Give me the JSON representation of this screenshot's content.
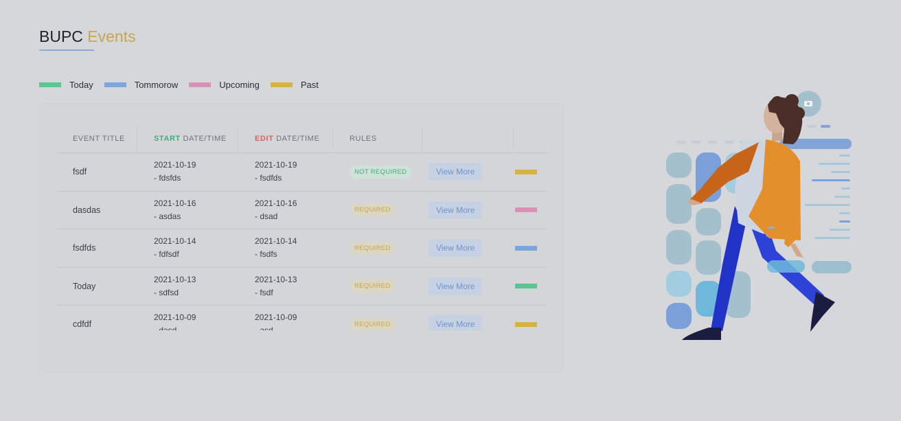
{
  "header": {
    "title_main": "BUPC",
    "title_accent": "Events"
  },
  "colors": {
    "today": "#5bc592",
    "tomorrow": "#7ca5de",
    "upcoming": "#d991b7",
    "past": "#d9b13d"
  },
  "legend": [
    {
      "label": "Today",
      "color": "#5bc592"
    },
    {
      "label": "Tommorow",
      "color": "#7ca5de"
    },
    {
      "label": "Upcoming",
      "color": "#d991b7"
    },
    {
      "label": "Past",
      "color": "#d9b13d"
    }
  ],
  "table": {
    "headers": {
      "event_title": "EVENT TITLE",
      "start_hl": "START",
      "start_rest": " DATE/TIME",
      "edit_hl": "EDIT",
      "edit_rest": " DATE/TIME",
      "rules": "RULES"
    },
    "view_more_label": "View More",
    "rows": [
      {
        "title": "fsdf",
        "start_date": "2021-10-19",
        "start_sub": "- fdsfds",
        "edit_date": "2021-10-19",
        "edit_sub": "- fsdfds",
        "rule": "NOT REQUIRED",
        "status": "upcoming-past",
        "bar_color": "#d9b13d"
      },
      {
        "title": "dasdas",
        "start_date": "2021-10-16",
        "start_sub": "- asdas",
        "edit_date": "2021-10-16",
        "edit_sub": "- dsad",
        "rule": "REQUIRED",
        "bar_color": "#d991b7"
      },
      {
        "title": "fsdfds",
        "start_date": "2021-10-14",
        "start_sub": "- fdfsdf",
        "edit_date": "2021-10-14",
        "edit_sub": "- fsdfs",
        "rule": "REQUIRED",
        "bar_color": "#7ca5de"
      },
      {
        "title": "Today",
        "start_date": "2021-10-13",
        "start_sub": "- sdfsd",
        "edit_date": "2021-10-13",
        "edit_sub": "- fsdf",
        "rule": "REQUIRED",
        "bar_color": "#5bc592"
      },
      {
        "title": "cdfdf",
        "start_date": "2021-10-09",
        "start_sub": "- dasd",
        "edit_date": "2021-10-09",
        "edit_sub": "- asd",
        "rule": "REQUIRED",
        "bar_color": "#d9b13d"
      }
    ]
  }
}
